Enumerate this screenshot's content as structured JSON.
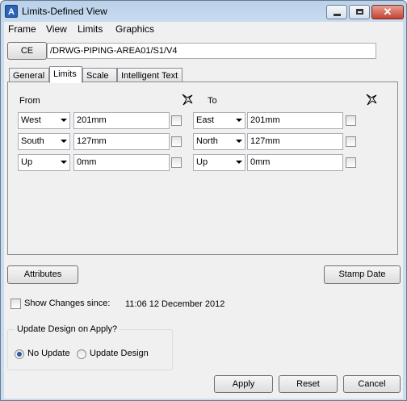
{
  "window": {
    "title": "Limits-Defined View",
    "app_icon_glyph": "A",
    "close_glyph": "✕"
  },
  "menubar": [
    "Frame",
    "View",
    "Limits",
    "Graphics"
  ],
  "ce": {
    "button_label": "CE",
    "path_value": "/DRWG-PIPING-AREA01/S1/V4"
  },
  "tabs": [
    "General",
    "Limits",
    "Scale",
    "Intelligent Text"
  ],
  "active_tab": "Limits",
  "limits": {
    "from_label": "From",
    "to_label": "To",
    "from_rows": [
      {
        "direction": "West",
        "value": "201mm"
      },
      {
        "direction": "South",
        "value": "127mm"
      },
      {
        "direction": "Up",
        "value": "0mm"
      }
    ],
    "to_rows": [
      {
        "direction": "East",
        "value": "201mm"
      },
      {
        "direction": "North",
        "value": "127mm"
      },
      {
        "direction": "Up",
        "value": "0mm"
      }
    ]
  },
  "buttons": {
    "attributes": "Attributes",
    "stamp_date": "Stamp Date",
    "apply": "Apply",
    "reset": "Reset",
    "cancel": "Cancel"
  },
  "show_changes": {
    "label": "Show Changes since:",
    "checked": false,
    "date": "11:06 12 December 2012"
  },
  "update_design": {
    "title": "Update Design on Apply?",
    "options": [
      "No Update",
      "Update Design"
    ],
    "selected": "No Update"
  },
  "colors": {
    "accent": "#2a5ca8",
    "titlebar": "#b9d1ea",
    "close": "#c4432f"
  }
}
